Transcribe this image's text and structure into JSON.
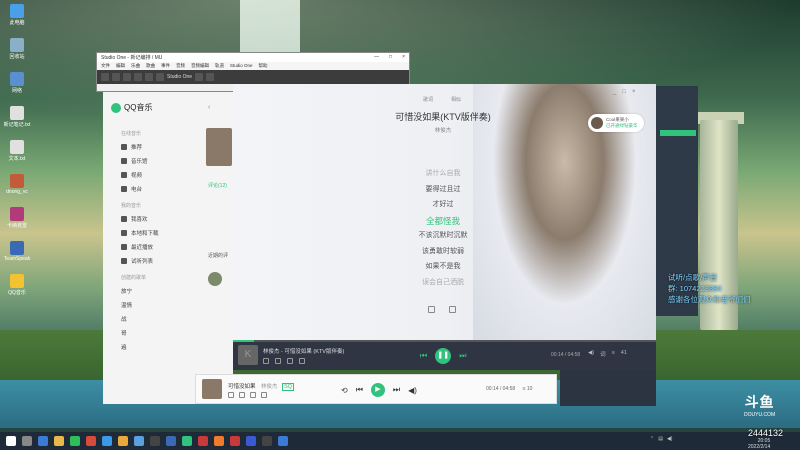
{
  "desktop": {
    "icons": [
      {
        "label": "此电脑",
        "color": "#4aa0e8"
      },
      {
        "label": "回收站",
        "color": "#8ab0c8"
      },
      {
        "label": "网络",
        "color": "#5a8fd0"
      },
      {
        "label": "新记笔记.txt",
        "color": "#e0e0e0"
      },
      {
        "label": "文本.txt",
        "color": "#e0e0e0"
      },
      {
        "label": "dnong_vc",
        "color": "#c55a3a"
      },
      {
        "label": "卡纳克雷",
        "color": "#b03a7a"
      },
      {
        "label": "TeamSpeak",
        "color": "#3a6ab5"
      },
      {
        "label": "QQ音乐",
        "color": "#f2c230"
      }
    ]
  },
  "studio_one": {
    "title": "Studio One - 新记编排 / MU",
    "window_controls": [
      "—",
      "□",
      "×"
    ],
    "menu": [
      "文件",
      "编辑",
      "乐曲",
      "歌曲",
      "事件",
      "音频",
      "音频编辑",
      "轨道",
      "Studio One",
      "帮助"
    ],
    "toolbar_text": "Studio One"
  },
  "qq_music": {
    "app_name": "QQ音乐",
    "sections": [
      {
        "heading": "在线音乐",
        "items": [
          "推荐",
          "音乐馆",
          "视频",
          "电台"
        ]
      },
      {
        "heading": "我的音乐",
        "items": [
          "我喜欢",
          "本地和下载",
          "最近播放",
          "试听列表"
        ]
      },
      {
        "heading": "创建的歌单",
        "items": [
          "旅宁",
          "温情",
          "战",
          "哥",
          "遍"
        ]
      }
    ],
    "mid_labels": [
      "评论(12)",
      "近期的评"
    ]
  },
  "lyrics_player": {
    "tabs": [
      "歌词",
      "相似"
    ],
    "song_title": "可惜没如果(KTV版伴奏)",
    "artist": "林俊杰",
    "lines": [
      "讲什么自我",
      "要得过且过",
      "才好过",
      "全都怪我",
      "不该沉默时沉默",
      "该勇敢时软弱",
      "如果不是我",
      "误会自己洒脱"
    ],
    "current_line_index": 3,
    "login_card": {
      "line1": "Cool果果小",
      "line2": "已开通绿钻豪华"
    },
    "window_buttons": [
      "_",
      "□",
      "×"
    ]
  },
  "player_bar": {
    "song": "林俊杰 - 可惜没如果 (KTV版伴奏)",
    "play_symbol": "❚❚",
    "prev_symbol": "⏮",
    "next_symbol": "⏭",
    "time": "00:14 / 04:58",
    "count": "41",
    "progress": 0.05
  },
  "mini_player": {
    "song": "可惜没如果",
    "artist": "林俊杰",
    "badge": "SQ",
    "time": "00:14 / 04:58",
    "play_symbol": "▶",
    "count": "10"
  },
  "chat": {
    "overlay_lines": [
      "试听/点歌/声音",
      "群: 1074223880",
      "感谢各位观众和老爷们们"
    ]
  },
  "brand": {
    "logo": "斗鱼",
    "url": "DOUYU.COM",
    "viewers": "2444132"
  },
  "taskbar": {
    "date": "2022/2/14",
    "time": "20:05"
  },
  "colors": {
    "accent": "#31c27c",
    "overlay_text": "#7dd3ff"
  }
}
